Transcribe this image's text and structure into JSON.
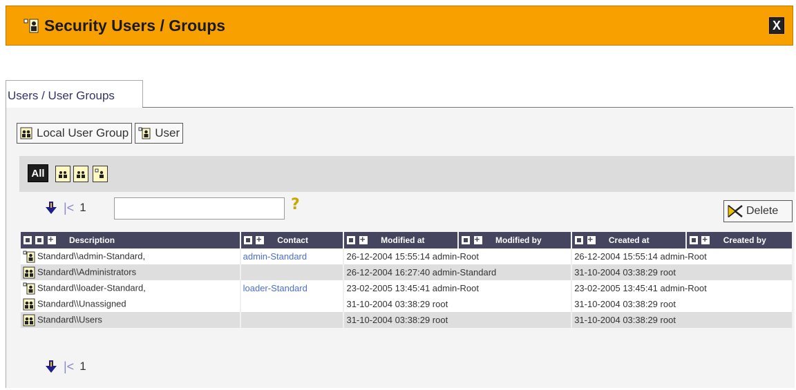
{
  "window": {
    "title": "Security Users / Groups",
    "close_label": "X"
  },
  "tabs": [
    {
      "label": "Users / User Groups"
    }
  ],
  "toolbar": {
    "new_group_label": "Local User Group",
    "new_user_label": "User"
  },
  "filter": {
    "all_label": "All"
  },
  "pager": {
    "page": "1",
    "first_symbol": "|<"
  },
  "search": {
    "value": "",
    "help_label": "?"
  },
  "delete_label": "Delete",
  "table": {
    "headers": {
      "description": "Description",
      "contact": "Contact",
      "modified_at": "Modified at",
      "modified_by": "Modified by",
      "created_at": "Created at",
      "created_by": "Created by"
    },
    "rows": [
      {
        "type": "user-icon",
        "description": "Standard\\\\admin-Standard,",
        "contact": "admin-Standard",
        "modified": "26-12-2004 15:55:14 admin-Root",
        "created": "26-12-2004 15:55:14 admin-Root"
      },
      {
        "type": "group-icon",
        "description": "Standard\\\\Administrators",
        "contact": "",
        "modified": "26-12-2004 16:27:40 admin-Standard",
        "created": "31-10-2004 03:38:29 root"
      },
      {
        "type": "user-icon",
        "description": "Standard\\\\loader-Standard,",
        "contact": "loader-Standard",
        "modified": "23-02-2005 13:45:41 admin-Root",
        "created": "23-02-2005 13:45:41 admin-Root"
      },
      {
        "type": "group-icon",
        "description": "Standard\\\\Unassigned",
        "contact": "",
        "modified": "31-10-2004 03:38:29 root",
        "created": "31-10-2004 03:38:29 root"
      },
      {
        "type": "group-icon",
        "description": "Standard\\\\Users",
        "contact": "",
        "modified": "31-10-2004 03:38:29 root",
        "created": "31-10-2004 03:38:29 root"
      }
    ]
  },
  "colors": {
    "titlebar": "#f7a000",
    "header": "#454560",
    "alt_row": "#dedede",
    "link": "#4a6ed0"
  }
}
